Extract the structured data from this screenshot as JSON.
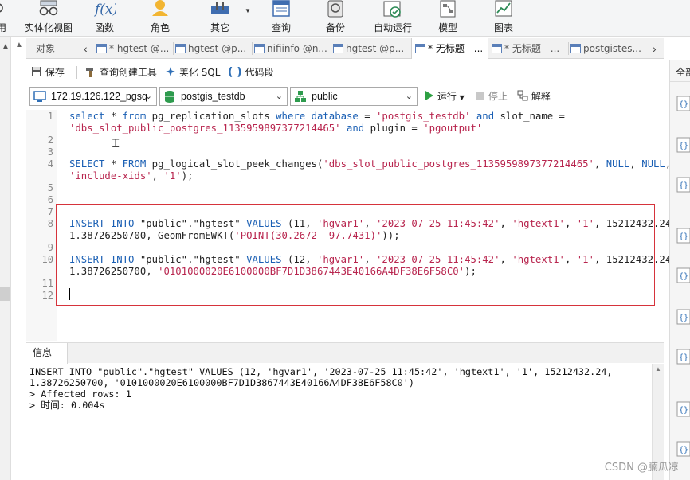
{
  "toolbar": {
    "items": [
      {
        "label": "用",
        "icon": "user-icon"
      },
      {
        "label": "实体化视图",
        "icon": "glasses-icon"
      },
      {
        "label": "函数",
        "icon": "function-icon"
      },
      {
        "label": "角色",
        "icon": "role-icon"
      },
      {
        "label": "其它",
        "icon": "tools-icon"
      },
      {
        "label": "查询",
        "icon": "query-icon"
      },
      {
        "label": "备份",
        "icon": "backup-icon"
      },
      {
        "label": "自动运行",
        "icon": "schedule-icon"
      },
      {
        "label": "模型",
        "icon": "model-icon"
      },
      {
        "label": "图表",
        "icon": "chart-icon"
      }
    ]
  },
  "tabs": {
    "objects": "对象",
    "items": [
      {
        "label": "* hgtest @..."
      },
      {
        "label": "hgtest @p..."
      },
      {
        "label": "nifiinfo @n..."
      },
      {
        "label": "hgtest @p..."
      },
      {
        "label": "* 无标题 - ...",
        "active": true
      },
      {
        "label": "* 无标题 - ..."
      },
      {
        "label": "postgistes..."
      }
    ]
  },
  "actions": {
    "save": "保存",
    "query_builder": "查询创建工具",
    "beautify": "美化 SQL",
    "code_snippet": "代码段",
    "run": "运行",
    "stop": "停止",
    "explain": "解释"
  },
  "selectors": {
    "connection": "172.19.126.122_pgsq",
    "database": "postgis_testdb",
    "schema": "public"
  },
  "editor": {
    "line_numbers": [
      "1",
      "2",
      "3",
      "4",
      "5",
      "6",
      "7",
      "8",
      "9",
      "10",
      "11",
      "12"
    ],
    "line1a": {
      "k1": "select",
      "t1": " * ",
      "k2": "from",
      "t2": " pg_replication_slots ",
      "k3": "where",
      "t3": " ",
      "k4": "database",
      "t4": " = ",
      "s1": "'postgis_testdb'",
      "t5": " ",
      "k5": "and",
      "t6": " slot_name ="
    },
    "line1b": {
      "s1": "'dbs_slot_public_postgres_1135959897377214465'",
      "t1": " ",
      "k1": "and",
      "t2": " plugin = ",
      "s2": "'pgoutput'"
    },
    "line4a": {
      "k1": "SELECT",
      "t1": " * ",
      "k2": "FROM",
      "t2": " pg_logical_slot_peek_changes(",
      "s1": "'dbs_slot_public_postgres_1135959897377214465'",
      "t3": ", ",
      "k3": "NULL",
      "t4": ", ",
      "k4": "NULL",
      "t5": ","
    },
    "line4b": {
      "s1": "'include-xids'",
      "t1": ", ",
      "s2": "'1'",
      "t2": ");"
    },
    "line8a": {
      "k1": "INSERT",
      "t1": " ",
      "k2": "INTO",
      "t2": " \"public\".\"hgtest\" ",
      "k3": "VALUES",
      "t3": " (11, ",
      "s1": "'hgvar1'",
      "t4": ", ",
      "s2": "'2023-07-25 11:45:42'",
      "t5": ", ",
      "s3": "'hgtext1'",
      "t6": ", ",
      "s4": "'1'",
      "t7": ", 15212432.24,"
    },
    "line8b": {
      "t1": "1.38726250700, GeomFromEWKT(",
      "s1": "'POINT(30.2672 -97.7431)'",
      "t2": "));"
    },
    "line10a": {
      "k1": "INSERT",
      "t1": " ",
      "k2": "INTO",
      "t2": " \"public\".\"hgtest\" ",
      "k3": "VALUES",
      "t3": " (12, ",
      "s1": "'hgvar1'",
      "t4": ", ",
      "s2": "'2023-07-25 11:45:42'",
      "t5": ", ",
      "s3": "'hgtext1'",
      "t6": ", ",
      "s4": "'1'",
      "t7": ", 15212432.24,"
    },
    "line10b": {
      "t1": "1.38726250700, ",
      "s1": "'0101000020E6100000BF7D1D3867443E40166A4DF38E6F58C0'",
      "t2": ");"
    }
  },
  "info": {
    "tab": "信息",
    "lines": [
      "INSERT INTO \"public\".\"hgtest\" VALUES (12, 'hgvar1', '2023-07-25 11:45:42', 'hgtext1', '1', 15212432.24,",
      "1.38726250700, '0101000020E6100000BF7D1D3867443E40166A4DF38E6F58C0')",
      "> Affected rows: 1",
      "> 时间: 0.004s"
    ]
  },
  "right_panel": {
    "label": "全部"
  },
  "watermark": "CSDN @腩瓜凉"
}
